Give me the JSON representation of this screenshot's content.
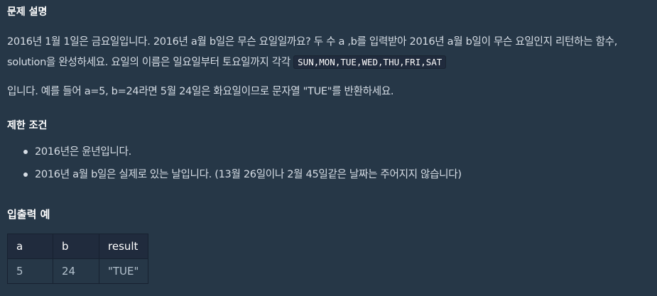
{
  "sections": {
    "problem_title": "문제 설명",
    "limit_title": "제한 조건",
    "example_title": "입출력 예"
  },
  "description": {
    "text1": "2016년 1월 1일은 금요일입니다. 2016년 a월 b일은 무슨 요일일까요? 두 수 a ,b를 입력받아 2016년 a월 b일이 무슨 요일인지 리턴하는 함수, solution을 완성하세요. 요일의 이름은 일요일부터 토요일까지 각각 ",
    "code": "SUN,MON,TUE,WED,THU,FRI,SAT",
    "text2": "입니다. 예를 들어 a=5, b=24라면 5월 24일은 화요일이므로 문자열 \"TUE\"를 반환하세요."
  },
  "limits": [
    "2016년은 윤년입니다.",
    "2016년 a월 b일은 실제로 있는 날입니다. (13월 26일이나 2월 45일같은 날짜는 주어지지 않습니다)"
  ],
  "example_table": {
    "headers": [
      "a",
      "b",
      "result"
    ],
    "rows": [
      [
        "5",
        "24",
        "\"TUE\""
      ]
    ]
  }
}
